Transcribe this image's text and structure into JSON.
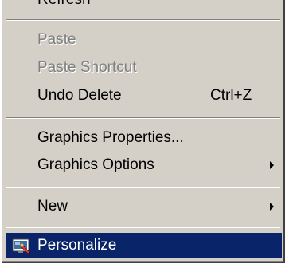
{
  "menu": {
    "top_item_label": "Refresh",
    "items": [
      {
        "label": "Paste",
        "enabled": false
      },
      {
        "label": "Paste Shortcut",
        "enabled": false
      },
      {
        "label": "Undo Delete",
        "shortcut": "Ctrl+Z",
        "enabled": true
      },
      {
        "label": "Graphics Properties...",
        "enabled": true
      },
      {
        "label": "Graphics Options",
        "enabled": true,
        "submenu": true
      },
      {
        "label": "New",
        "enabled": true,
        "submenu": true
      },
      {
        "label": "Personalize",
        "enabled": true,
        "selected": true,
        "icon": "personalize-icon"
      }
    ]
  },
  "colors": {
    "menu_background": "#d4d0c8",
    "highlight": "#0a246a",
    "disabled_text": "#808080"
  }
}
